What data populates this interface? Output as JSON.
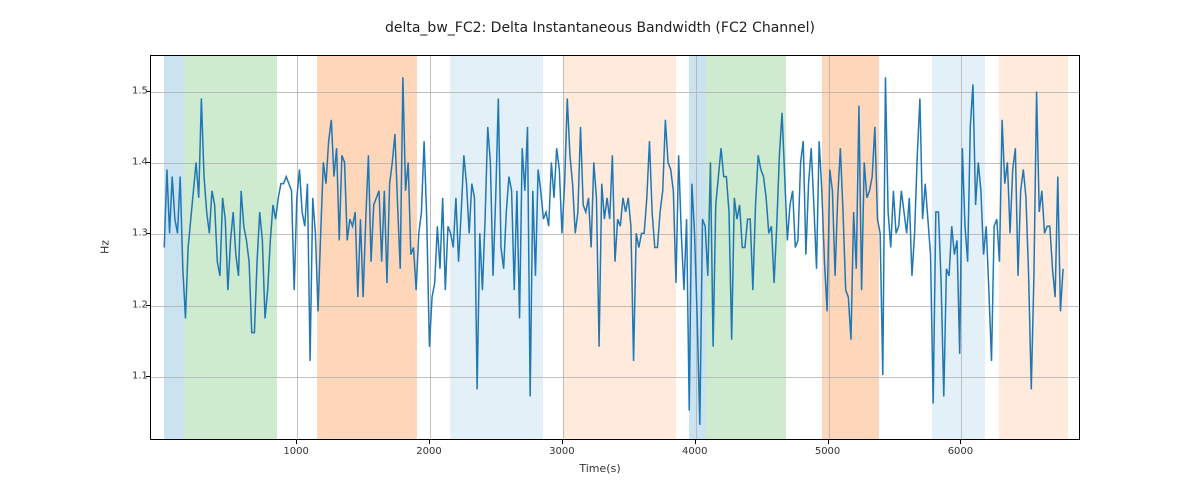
{
  "chart_data": {
    "type": "line",
    "title": "delta_bw_FC2: Delta Instantaneous Bandwidth (FC2 Channel)",
    "xlabel": "Time(s)",
    "ylabel": "Hz",
    "xlim": [
      -100,
      6900
    ],
    "ylim": [
      1.01,
      1.55
    ],
    "xticks": [
      1000,
      2000,
      3000,
      4000,
      5000,
      6000
    ],
    "yticks": [
      1.1,
      1.2,
      1.3,
      1.4,
      1.5
    ],
    "bands": [
      {
        "x0": 0,
        "x1": 150,
        "color": "#6baed6",
        "alpha": 0.35
      },
      {
        "x0": 150,
        "x1": 850,
        "color": "#74c476",
        "alpha": 0.35
      },
      {
        "x0": 1150,
        "x1": 1900,
        "color": "#fd8d3c",
        "alpha": 0.35
      },
      {
        "x0": 2150,
        "x1": 2850,
        "color": "#6baed6",
        "alpha": 0.18
      },
      {
        "x0": 3000,
        "x1": 3850,
        "color": "#fd8d3c",
        "alpha": 0.18
      },
      {
        "x0": 3950,
        "x1": 4080,
        "color": "#6baed6",
        "alpha": 0.35
      },
      {
        "x0": 4080,
        "x1": 4680,
        "color": "#74c476",
        "alpha": 0.35
      },
      {
        "x0": 4950,
        "x1": 5380,
        "color": "#fd8d3c",
        "alpha": 0.35
      },
      {
        "x0": 5780,
        "x1": 6180,
        "color": "#6baed6",
        "alpha": 0.18
      },
      {
        "x0": 6280,
        "x1": 6800,
        "color": "#fd8d3c",
        "alpha": 0.18
      }
    ],
    "series": [
      {
        "name": "delta_bw_FC2",
        "x_step": 20,
        "x_start": 0,
        "values": [
          1.28,
          1.39,
          1.3,
          1.38,
          1.32,
          1.3,
          1.38,
          1.25,
          1.18,
          1.28,
          1.32,
          1.36,
          1.4,
          1.35,
          1.49,
          1.38,
          1.33,
          1.3,
          1.36,
          1.34,
          1.26,
          1.24,
          1.35,
          1.32,
          1.22,
          1.29,
          1.33,
          1.27,
          1.24,
          1.36,
          1.31,
          1.29,
          1.26,
          1.16,
          1.16,
          1.26,
          1.33,
          1.29,
          1.18,
          1.22,
          1.29,
          1.34,
          1.32,
          1.35,
          1.37,
          1.37,
          1.38,
          1.37,
          1.36,
          1.22,
          1.35,
          1.39,
          1.33,
          1.31,
          1.37,
          1.12,
          1.35,
          1.3,
          1.19,
          1.3,
          1.4,
          1.37,
          1.43,
          1.46,
          1.38,
          1.42,
          1.29,
          1.41,
          1.4,
          1.29,
          1.32,
          1.31,
          1.33,
          1.21,
          1.32,
          1.21,
          1.32,
          1.41,
          1.26,
          1.34,
          1.35,
          1.36,
          1.26,
          1.36,
          1.23,
          1.37,
          1.4,
          1.44,
          1.34,
          1.25,
          1.52,
          1.36,
          1.4,
          1.27,
          1.28,
          1.22,
          1.3,
          1.33,
          1.43,
          1.32,
          1.14,
          1.21,
          1.23,
          1.31,
          1.25,
          1.35,
          1.22,
          1.31,
          1.3,
          1.28,
          1.35,
          1.26,
          1.33,
          1.41,
          1.37,
          1.3,
          1.37,
          1.35,
          1.08,
          1.3,
          1.22,
          1.32,
          1.45,
          1.4,
          1.24,
          1.35,
          1.49,
          1.28,
          1.25,
          1.33,
          1.38,
          1.36,
          1.22,
          1.36,
          1.18,
          1.42,
          1.36,
          1.45,
          1.07,
          1.36,
          1.24,
          1.39,
          1.36,
          1.32,
          1.33,
          1.31,
          1.4,
          1.35,
          1.42,
          1.39,
          1.3,
          1.37,
          1.49,
          1.41,
          1.37,
          1.3,
          1.33,
          1.45,
          1.34,
          1.33,
          1.35,
          1.28,
          1.4,
          1.35,
          1.14,
          1.37,
          1.32,
          1.35,
          1.32,
          1.41,
          1.26,
          1.32,
          1.31,
          1.35,
          1.33,
          1.35,
          1.31,
          1.12,
          1.3,
          1.28,
          1.3,
          1.3,
          1.35,
          1.43,
          1.33,
          1.28,
          1.28,
          1.33,
          1.36,
          1.46,
          1.4,
          1.39,
          1.36,
          1.23,
          1.41,
          1.3,
          1.22,
          1.32,
          1.05,
          1.37,
          1.3,
          1.18,
          1.03,
          1.32,
          1.31,
          1.24,
          1.4,
          1.14,
          1.34,
          1.38,
          1.42,
          1.38,
          1.38,
          1.33,
          1.15,
          1.35,
          1.32,
          1.34,
          1.28,
          1.28,
          1.32,
          1.32,
          1.22,
          1.34,
          1.41,
          1.39,
          1.38,
          1.35,
          1.3,
          1.31,
          1.23,
          1.31,
          1.41,
          1.47,
          1.38,
          1.29,
          1.34,
          1.36,
          1.28,
          1.29,
          1.4,
          1.43,
          1.27,
          1.37,
          1.42,
          1.34,
          1.25,
          1.43,
          1.36,
          1.26,
          1.19,
          1.39,
          1.36,
          1.24,
          1.35,
          1.42,
          1.33,
          1.22,
          1.21,
          1.15,
          1.33,
          1.25,
          1.48,
          1.22,
          1.4,
          1.35,
          1.36,
          1.38,
          1.45,
          1.32,
          1.3,
          1.1,
          1.52,
          1.33,
          1.28,
          1.36,
          1.3,
          1.31,
          1.36,
          1.33,
          1.3,
          1.35,
          1.24,
          1.3,
          1.41,
          1.49,
          1.32,
          1.37,
          1.32,
          1.27,
          1.06,
          1.33,
          1.33,
          1.23,
          1.07,
          1.25,
          1.24,
          1.31,
          1.27,
          1.29,
          1.13,
          1.42,
          1.31,
          1.26,
          1.45,
          1.51,
          1.34,
          1.4,
          1.36,
          1.27,
          1.31,
          1.22,
          1.12,
          1.31,
          1.32,
          1.26,
          1.46,
          1.37,
          1.4,
          1.3,
          1.39,
          1.42,
          1.24,
          1.36,
          1.39,
          1.35,
          1.24,
          1.08,
          1.24,
          1.5,
          1.33,
          1.36,
          1.3,
          1.31,
          1.31,
          1.25,
          1.21,
          1.38,
          1.19,
          1.25
        ]
      }
    ]
  }
}
